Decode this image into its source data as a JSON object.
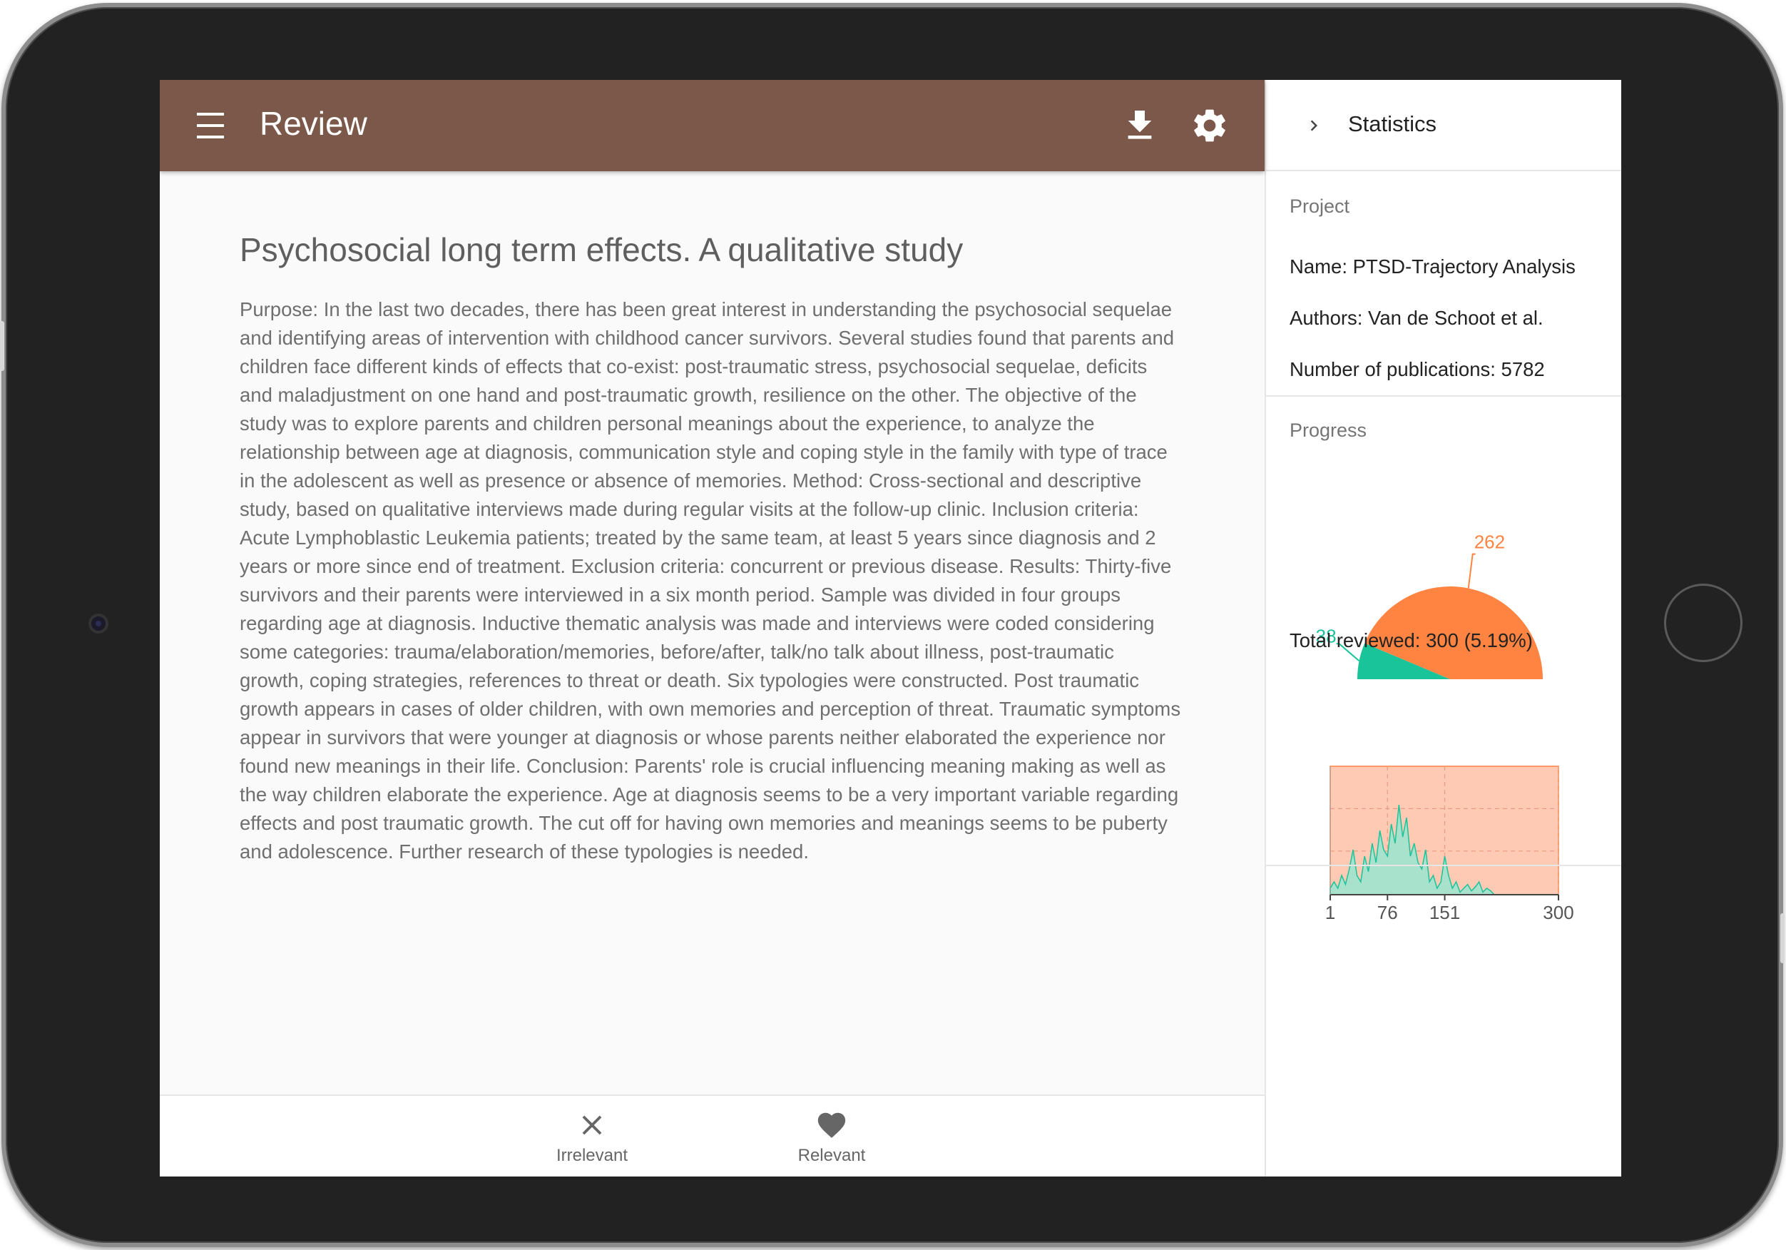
{
  "app": {
    "title": "Review"
  },
  "article": {
    "title": "Psychosocial long term effects. A qualitative study",
    "abstract": "Purpose: In the last two decades, there has been great interest in understanding the psychosocial sequelae and identifying areas of intervention with childhood cancer survivors. Several studies found that parents and children face different kinds of effects that co-exist: post-traumatic stress, psychosocial sequelae, deficits and maladjustment on one hand and post-traumatic growth, resilience on the other. The objective of the study was to explore parents and children personal meanings about the experience, to analyze the relationship between age at diagnosis, communication style and coping style in the family with type of trace in the adolescent as well as presence or absence of memories. Method: Cross-sectional and descriptive study, based on qualitative interviews made during regular visits at the follow-up clinic. Inclusion criteria: Acute Lymphoblastic Leukemia patients; treated by the same team, at least 5 years since diagnosis and 2 years or more since end of treatment. Exclusion criteria: concurrent or previous disease. Results: Thirty-five survivors and their parents were interviewed in a six month period. Sample was divided in four groups regarding age at diagnosis. Inductive thematic analysis was made and interviews were coded considering some categories: trauma/elaboration/memories, before/after, talk/no talk about illness, post-traumatic growth, coping strategies, references to threat or death. Six typologies were constructed. Post traumatic growth appears in cases of older children, with own memories and perception of threat. Traumatic symptoms appear in survivors that were younger at diagnosis or whose parents neither elaborated the experience nor found new meanings in their life. Conclusion: Parents' role is crucial influencing meaning making as well as the way children elaborate the experience. Age at diagnosis seems to be a very important variable regarding effects and post traumatic growth. The cut off for having own memories and meanings seems to be puberty and adolescence. Further research of these typologies is needed."
  },
  "actions": {
    "irrelevant": "Irrelevant",
    "relevant": "Relevant"
  },
  "panel": {
    "title": "Statistics",
    "project_heading": "Project",
    "name": "Name: PTSD-Trajectory Analysis",
    "authors": "Authors: Van de Schoot et al.",
    "publications": "Number of publications: 5782",
    "progress_heading": "Progress",
    "total_reviewed": "Total reviewed: 300 (5.19%)"
  },
  "colors": {
    "appbar": "#7b5849",
    "irrelevant": "#ff8442",
    "relevant": "#1ac49b"
  },
  "icons": {
    "menu": "menu-icon",
    "download": "download-icon",
    "settings": "gear-icon",
    "collapse": "chevron-right-icon",
    "irrelevant": "close-icon",
    "relevant": "heart-icon"
  },
  "chart_data": [
    {
      "type": "pie",
      "labels": [
        "262",
        "38"
      ],
      "values": [
        262,
        38
      ],
      "colors": [
        "#ff8442",
        "#1ac49b"
      ],
      "shape": "half-donut"
    },
    {
      "type": "area",
      "xticks": [
        "1",
        "76",
        "151",
        "300"
      ],
      "xlim": [
        1,
        300
      ],
      "grid": true,
      "background_color": "#ffcab3",
      "series": [
        {
          "color": "#1ac49b",
          "x": [
            1,
            6,
            11,
            16,
            21,
            26,
            31,
            36,
            41,
            46,
            51,
            56,
            61,
            66,
            71,
            76,
            81,
            86,
            91,
            96,
            101,
            106,
            111,
            116,
            121,
            126,
            131,
            136,
            141,
            146,
            151,
            156,
            161,
            166,
            171,
            176,
            181,
            186,
            191,
            196,
            201,
            206,
            211,
            216
          ],
          "y": [
            0.05,
            0.1,
            0.05,
            0.15,
            0.08,
            0.2,
            0.35,
            0.15,
            0.1,
            0.3,
            0.18,
            0.4,
            0.25,
            0.5,
            0.35,
            0.3,
            0.55,
            0.4,
            0.7,
            0.45,
            0.6,
            0.3,
            0.4,
            0.25,
            0.2,
            0.35,
            0.1,
            0.15,
            0.05,
            0.1,
            0.3,
            0.15,
            0.05,
            0.1,
            0.02,
            0.05,
            0.08,
            0.03,
            0.06,
            0.1,
            0.02,
            0.05,
            0.03,
            0.0
          ]
        }
      ]
    }
  ]
}
